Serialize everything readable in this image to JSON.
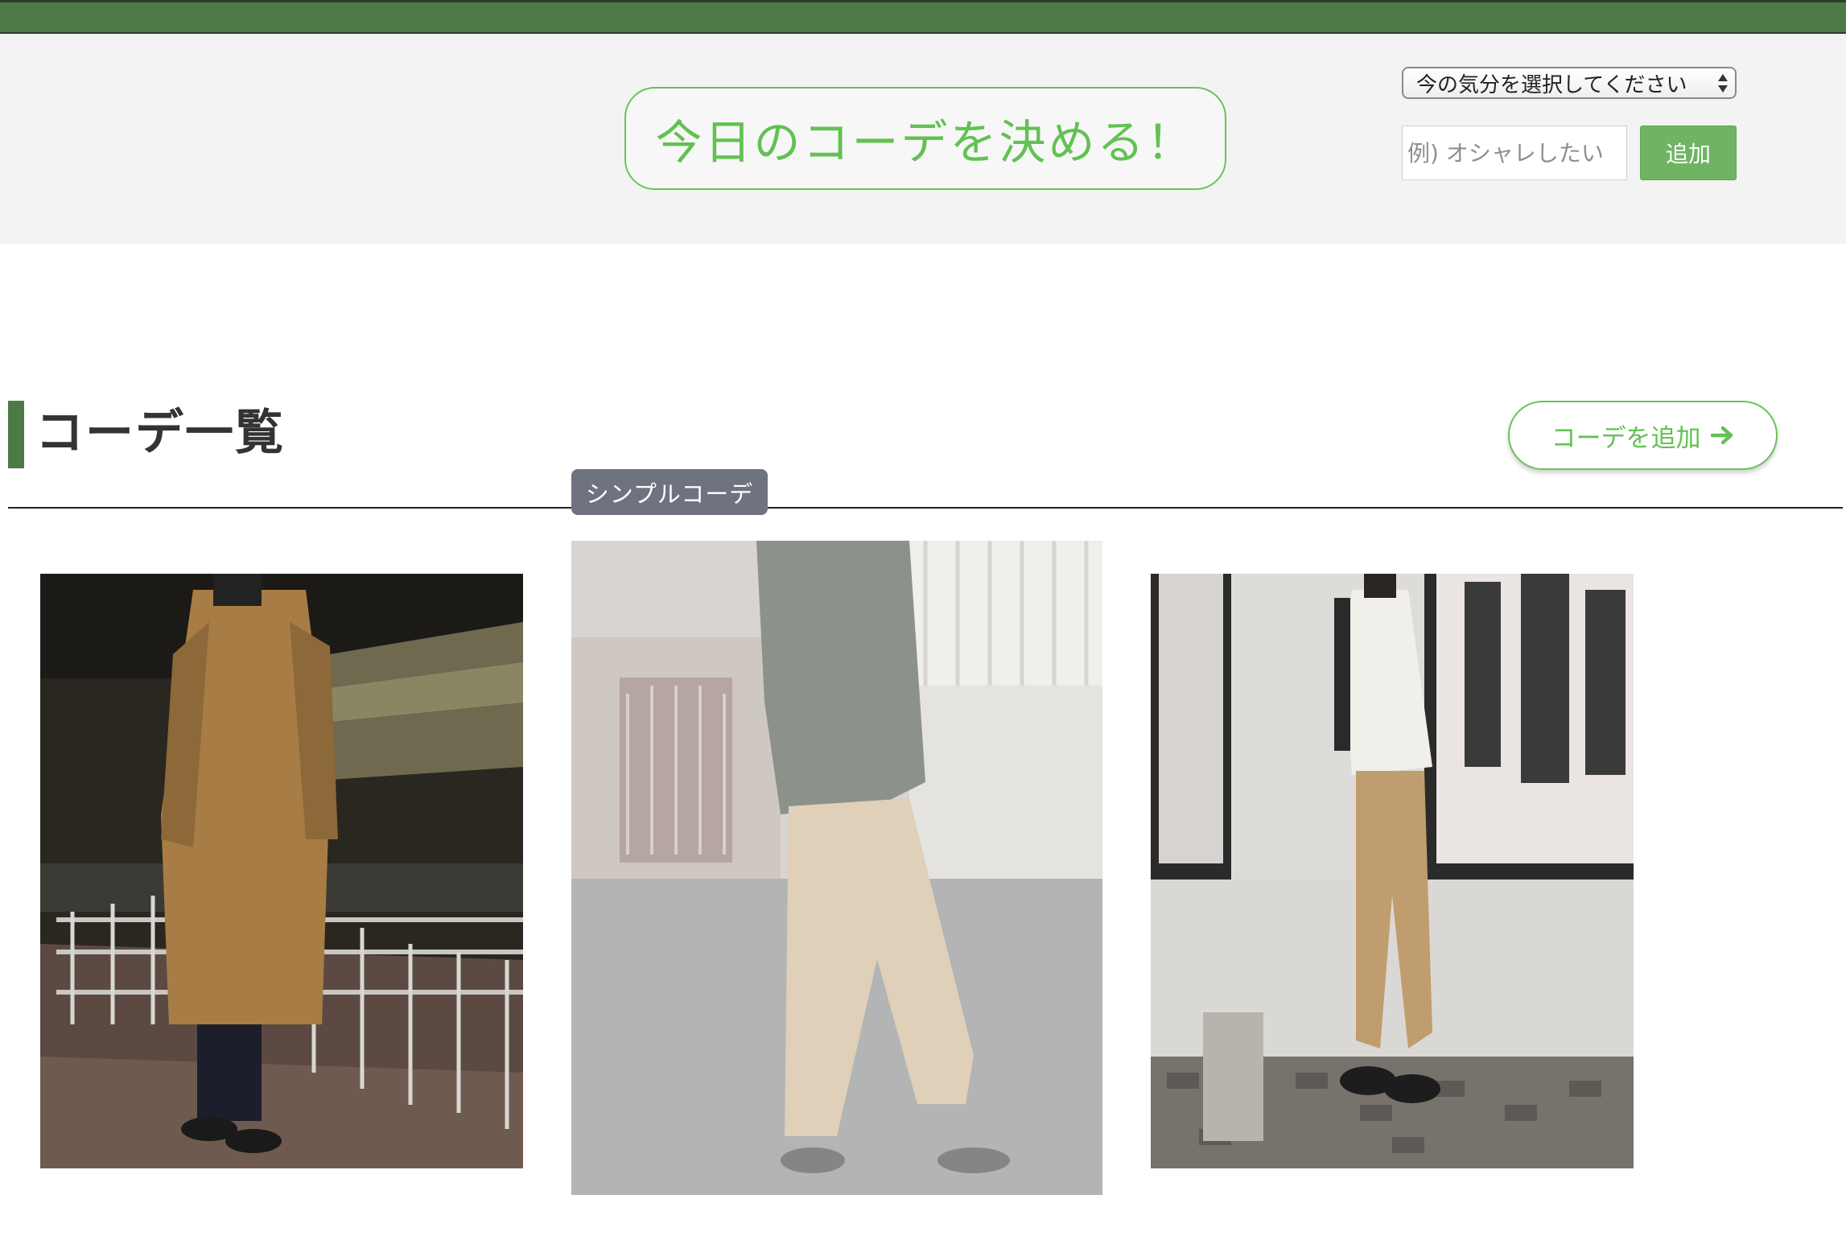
{
  "header": {
    "decide_button": "今日のコーデを決める！",
    "mood_select": {
      "selected": "今の気分を選択してください"
    },
    "mood_input": {
      "placeholder": "例) オシャレしたい"
    },
    "add_button": "追加"
  },
  "section": {
    "title": "コーデ一覧",
    "add_coordinate_button": "コーデを追加"
  },
  "cards": [
    {
      "tooltip": ""
    },
    {
      "tooltip": "シンプルコーデ"
    },
    {
      "tooltip": ""
    }
  ],
  "icons": {
    "add_coordinate": "arrow-right-icon",
    "select": "sort-arrows-icon"
  },
  "colors": {
    "brand_green": "#4b7a44",
    "accent_green": "#62c152",
    "button_green": "#6fb463"
  }
}
